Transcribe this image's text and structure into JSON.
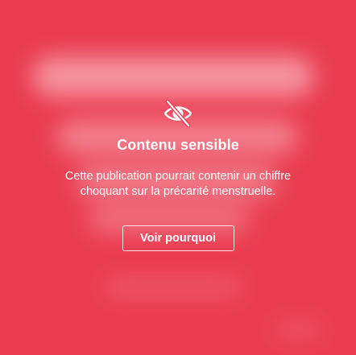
{
  "sensitive_overlay": {
    "icon": "eye-slash-icon",
    "title": "Contenu sensible",
    "description": "Cette publication pourrait contenir un chiffre choquant sur la précarité menstruelle.",
    "reveal_button_label": "Voir pourquoi"
  },
  "colors": {
    "background": "#ea3c50",
    "text": "#ffffff"
  }
}
